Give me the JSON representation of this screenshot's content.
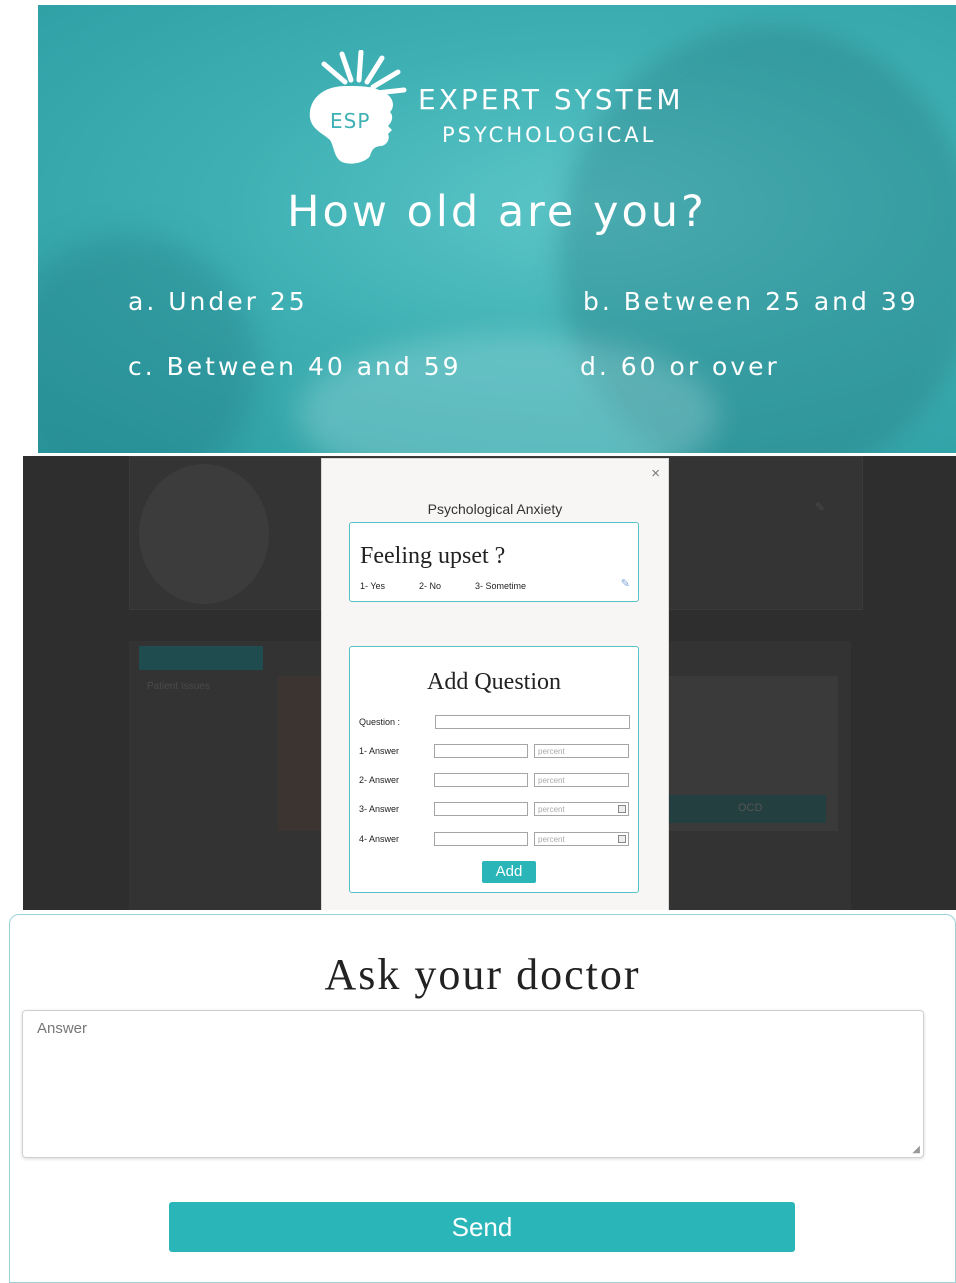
{
  "hero": {
    "logo_text": "ESP",
    "brand_line1": "EXPERT SYSTEM",
    "brand_line2": "PSYCHOLOGICAL",
    "question": "How old are you?",
    "options": [
      "a. Under 25",
      "b. Between 25 and 39",
      "c. Between 40 and 59",
      "d. 60 or over"
    ]
  },
  "background_page": {
    "sidebar_item": "Patient Issues",
    "photo_caption": "OCD"
  },
  "modal": {
    "close_icon": "×",
    "title": "Psychological Anxiety",
    "question_card": {
      "question": "Feeling upset ?",
      "answers": [
        "1- Yes",
        "2- No",
        "3- Sometime"
      ],
      "edit_icon": "pencil-icon"
    },
    "add_question": {
      "title": "Add Question",
      "question_label": "Question :",
      "answer_labels": [
        "1- Answer",
        "2- Answer",
        "3- Answer",
        "4- Answer"
      ],
      "percent_placeholder": "percent",
      "add_label": "Add"
    }
  },
  "ask_doctor": {
    "title": "Ask your doctor",
    "answer_placeholder": "Answer",
    "send_label": "Send"
  },
  "colors": {
    "accent": "#2ab6b9",
    "hero_teal": "#3fb1b4",
    "card_border": "#58c1c8",
    "overlay": "#2e2e2e"
  }
}
